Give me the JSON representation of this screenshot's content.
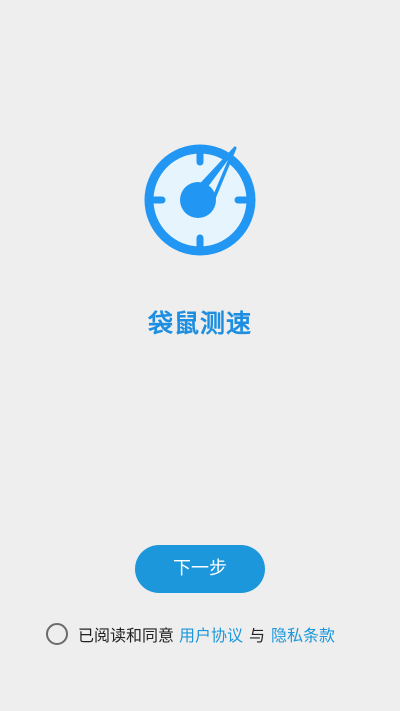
{
  "app": {
    "name": "袋鼠测速",
    "logo_icon": "speedometer-icon",
    "accent_color": "#1e8fe0"
  },
  "actions": {
    "next_label": "下一步"
  },
  "agreement": {
    "prefix": "已阅读和同意",
    "user_agreement_link": "用户协议",
    "connector": "与",
    "privacy_link": "隐私条款",
    "checked": false
  }
}
